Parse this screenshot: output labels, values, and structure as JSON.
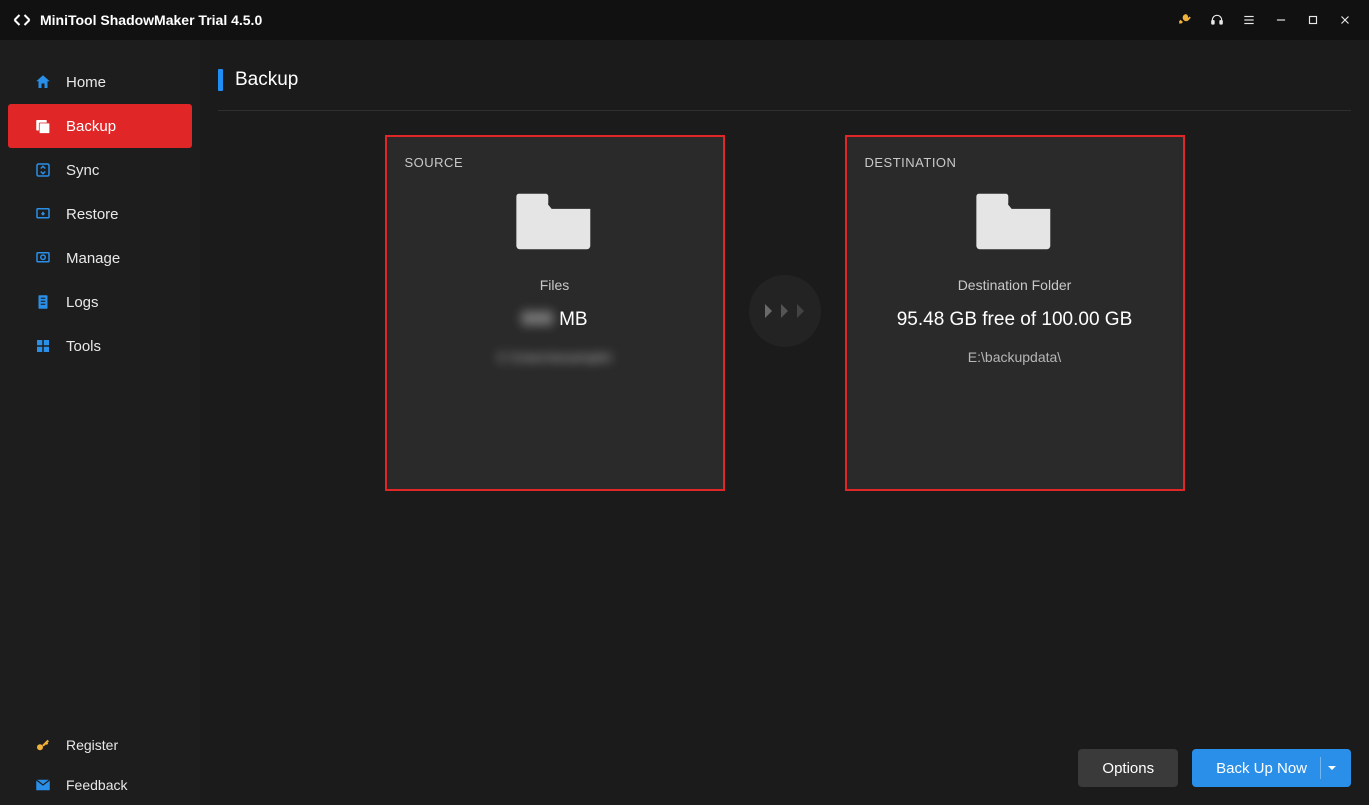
{
  "titlebar": {
    "app_title": "MiniTool ShadowMaker Trial 4.5.0"
  },
  "sidebar": {
    "items": [
      {
        "id": "home",
        "label": "Home"
      },
      {
        "id": "backup",
        "label": "Backup",
        "active": true
      },
      {
        "id": "sync",
        "label": "Sync"
      },
      {
        "id": "restore",
        "label": "Restore"
      },
      {
        "id": "manage",
        "label": "Manage"
      },
      {
        "id": "logs",
        "label": "Logs"
      },
      {
        "id": "tools",
        "label": "Tools"
      }
    ],
    "bottom": [
      {
        "id": "register",
        "label": "Register"
      },
      {
        "id": "feedback",
        "label": "Feedback"
      }
    ]
  },
  "page": {
    "title": "Backup"
  },
  "source": {
    "caption": "SOURCE",
    "type_label": "Files",
    "size_obscured_prefix": "000",
    "size_unit": "MB",
    "path_obscured": "C:\\Users\\example\\"
  },
  "destination": {
    "caption": "DESTINATION",
    "type_label": "Destination Folder",
    "space_text": "95.48 GB free of 100.00 GB",
    "path": "E:\\backupdata\\"
  },
  "footer": {
    "options_label": "Options",
    "backup_label": "Back Up Now"
  }
}
